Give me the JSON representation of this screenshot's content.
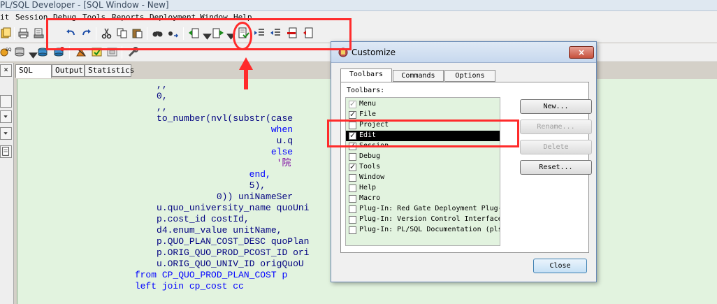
{
  "window": {
    "title": "PL/SQL Developer - [SQL Window - New]"
  },
  "menu": [
    "it",
    "Session",
    "Debug",
    "Tools",
    "Reports",
    "Deployment",
    "Window",
    "Help"
  ],
  "toolbar_icons": {
    "row1": [
      "new-icon",
      "print-icon",
      "print-preview-icon",
      "undo-icon",
      "redo-icon",
      "cut-icon",
      "copy-icon",
      "paste-icon",
      "find-icon",
      "replace-icon",
      "indent-icon",
      "unindent-icon",
      "comment-icon",
      "uncomment-icon",
      "syntax-check-icon",
      "uppercase-icon",
      "lowercase-icon",
      "clear-icon",
      "format-icon"
    ],
    "row2": [
      "sql-icon",
      "database-icon",
      "execute-icon",
      "break-icon",
      "explain-icon",
      "commit-icon",
      "rollback-icon",
      "tools-icon"
    ]
  },
  "tabs": [
    "SQL",
    "Output",
    "Statistics"
  ],
  "code_lines": [
    {
      "indent": "                         ",
      "text": ",,",
      "cls": "pl"
    },
    {
      "indent": "                         ",
      "text": "0,",
      "cls": "pl"
    },
    {
      "indent": "                         ",
      "text": ",,",
      "cls": "pl"
    },
    {
      "indent": "                         ",
      "text": "to_number(nvl(substr(case",
      "cls": "pl"
    },
    {
      "indent": "                                              ",
      "text": "when",
      "cls": "kw"
    },
    {
      "indent": "                                               ",
      "text": "u.q",
      "cls": "pl"
    },
    {
      "indent": "                                              ",
      "text": "else",
      "cls": "kw"
    },
    {
      "indent": "                                               ",
      "text": "'院",
      "cls": "nm"
    },
    {
      "indent": "                                          ",
      "text": "end,",
      "cls": "kw"
    },
    {
      "indent": "                                          ",
      "text": "5),",
      "cls": "pl"
    },
    {
      "indent": "                                    ",
      "text": "0)) uniNameSer",
      "cls": "pl"
    },
    {
      "indent": "                         ",
      "text": "u.quo_university_name quoUni",
      "cls": "pl"
    },
    {
      "indent": "                         ",
      "text": "p.cost_id costId,",
      "cls": "pl"
    },
    {
      "indent": "                         ",
      "text": "d4.enum_value unitName,",
      "cls": "pl"
    },
    {
      "indent": "                         ",
      "text": "p.QUO_PLAN_COST_DESC quoPlan",
      "cls": "pl"
    },
    {
      "indent": "                         ",
      "text": "p.ORIG_QUO_PROD_PCOST_ID ori",
      "cls": "pl"
    },
    {
      "indent": "                         ",
      "text": "u.ORIG_QUO_UNIV_ID origQuoU",
      "cls": "pl"
    },
    {
      "indent": "                     ",
      "text": "from CP_QUO_PROD_PLAN_COST p",
      "cls": "kw"
    },
    {
      "indent": "                     ",
      "text": "left join cp_cost cc",
      "cls": "kw"
    }
  ],
  "dialog": {
    "title": "Customize",
    "close_glyph": "×",
    "tabs": [
      "Toolbars",
      "Commands",
      "Options"
    ],
    "toolbars_label": "Toolbars:",
    "toolbars": [
      {
        "label": "Menu",
        "checked": true,
        "dim": true
      },
      {
        "label": "File",
        "checked": true
      },
      {
        "label": "Project",
        "checked": false
      },
      {
        "label": "Edit",
        "checked": true,
        "selected": true
      },
      {
        "label": "Session",
        "checked": true
      },
      {
        "label": "Debug",
        "checked": false
      },
      {
        "label": "Tools",
        "checked": true
      },
      {
        "label": "Window",
        "checked": false
      },
      {
        "label": "Help",
        "checked": false
      },
      {
        "label": "Macro",
        "checked": false
      },
      {
        "label": "Plug-In: Red Gate Deployment Plug-I",
        "checked": false
      },
      {
        "label": "Plug-In: Version Control Interface",
        "checked": false
      },
      {
        "label": "Plug-In: PL/SQL Documentation (plsd",
        "checked": false
      }
    ],
    "buttons": [
      {
        "label": "New...",
        "enabled": true
      },
      {
        "label": "Rename...",
        "enabled": false
      },
      {
        "label": "Delete",
        "enabled": false
      },
      {
        "label": "Reset...",
        "enabled": true
      }
    ],
    "close_label": "Close"
  },
  "colors": {
    "editor_bg": "#e2f3df",
    "annotation": "#ff2b2b",
    "keyword": "#0000ff"
  }
}
